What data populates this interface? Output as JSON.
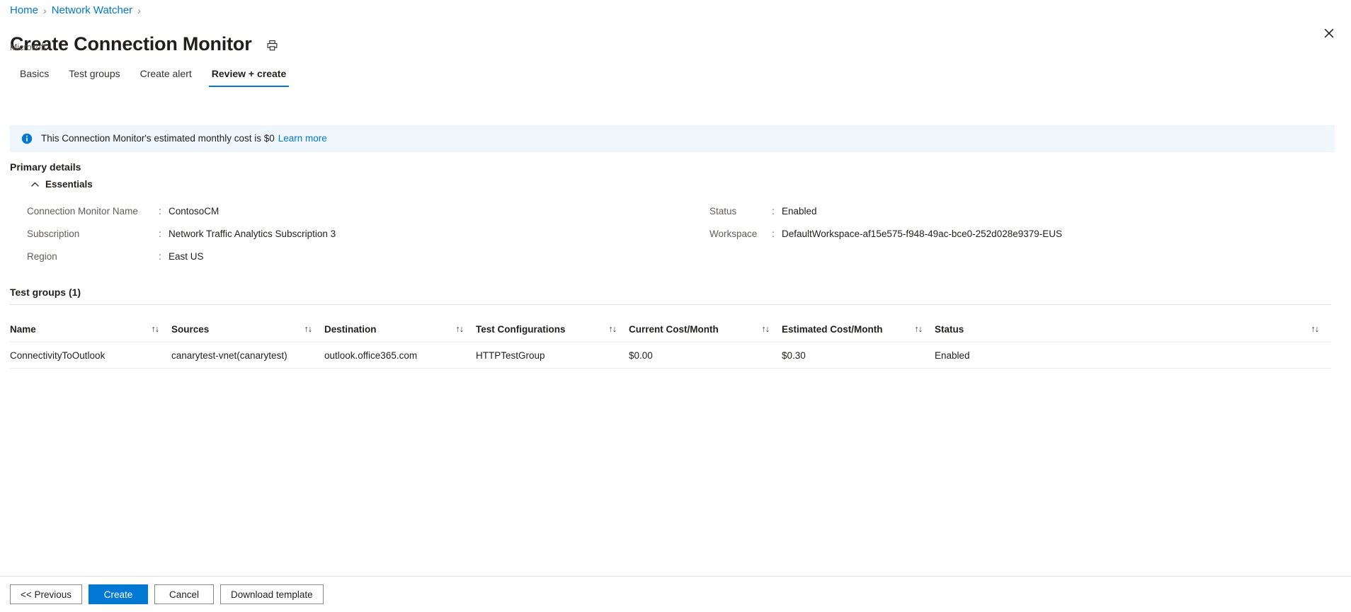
{
  "breadcrumb": {
    "items": [
      {
        "label": "Home"
      },
      {
        "label": "Network Watcher"
      }
    ],
    "separator": "›"
  },
  "header": {
    "title": "Create Connection Monitor",
    "subtitle": "Microsoft",
    "print_icon": "print-icon",
    "close_icon": "close-icon"
  },
  "tabs": [
    {
      "label": "Basics",
      "active": false
    },
    {
      "label": "Test groups",
      "active": false
    },
    {
      "label": "Create alert",
      "active": false
    },
    {
      "label": "Review + create",
      "active": true
    }
  ],
  "info_banner": {
    "icon": "info-icon",
    "text": "This Connection Monitor's estimated monthly cost is $0",
    "link_label": "Learn more",
    "background_color": "#eff6fc",
    "icon_color": "#0078d4"
  },
  "primary_details": {
    "section_label": "Primary details",
    "essentials": {
      "label": "Essentials",
      "expanded": true,
      "chevron_icon": "chevron-up-icon"
    },
    "left_fields": [
      {
        "key": "Connection Monitor Name",
        "colon": ":",
        "value": "ContosoCM"
      },
      {
        "key": "Subscription",
        "colon": ":",
        "value": "Network Traffic Analytics Subscription 3"
      },
      {
        "key": "Region",
        "colon": ":",
        "value": "East US"
      }
    ],
    "right_fields": [
      {
        "key": "Status",
        "colon": ":",
        "value": "Enabled"
      },
      {
        "key": "Workspace",
        "colon": ":",
        "value": "DefaultWorkspace-af15e575-f948-49ac-bce0-252d028e9379-EUS"
      }
    ]
  },
  "test_groups": {
    "title": "Test groups (1)",
    "sort_icon": "↑↓",
    "columns": [
      "Name",
      "Sources",
      "Destination",
      "Test Configurations",
      "Current Cost/Month",
      "Estimated Cost/Month",
      "Status"
    ],
    "rows": [
      {
        "name": "ConnectivityToOutlook",
        "sources": "canarytest-vnet(canarytest)",
        "destination": "outlook.office365.com",
        "test_configurations": "HTTPTestGroup",
        "current_cost": "$0.00",
        "estimated_cost": "$0.30",
        "status": "Enabled"
      }
    ]
  },
  "footer": {
    "buttons": [
      {
        "label": "<< Previous",
        "primary": false
      },
      {
        "label": "Create",
        "primary": true
      },
      {
        "label": "Cancel",
        "primary": false
      },
      {
        "label": "Download template",
        "primary": false
      }
    ],
    "primary_color": "#0078d4"
  }
}
